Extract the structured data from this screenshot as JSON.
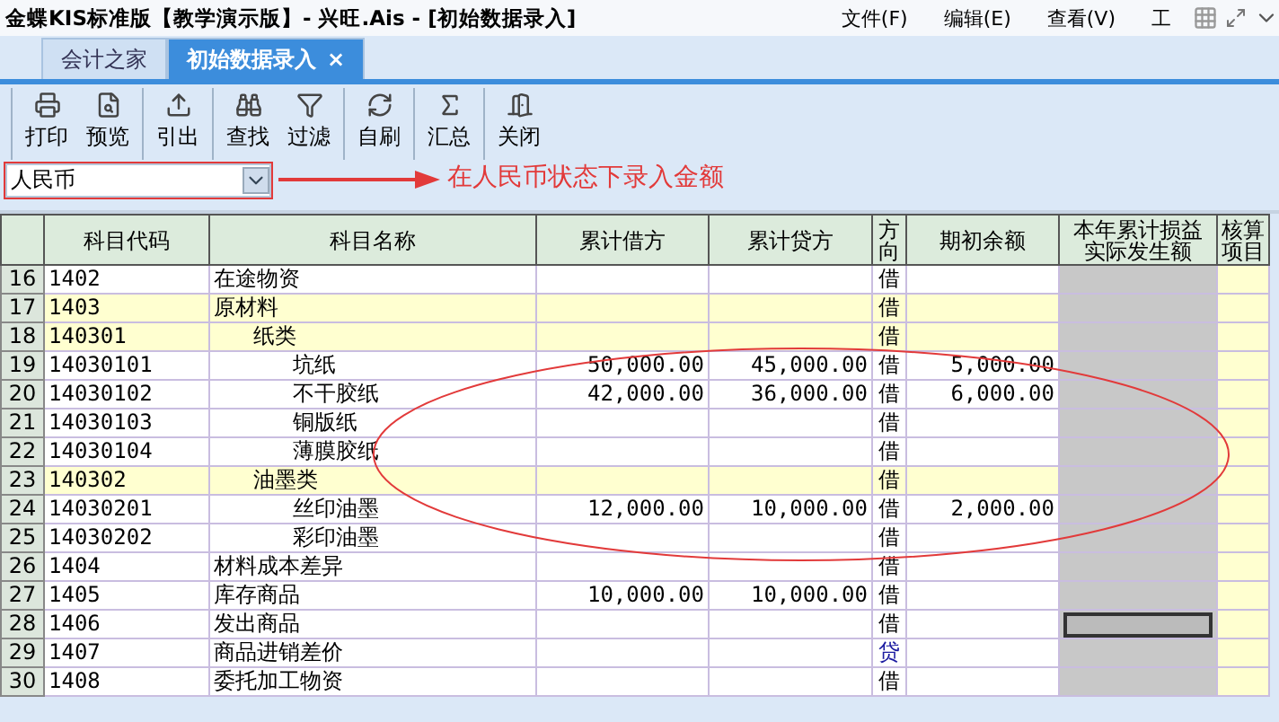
{
  "title_bar": {
    "title": "金蝶KIS标准版【教学演示版】- 兴旺.Ais - [初始数据录入]",
    "menu": [
      "文件(F)",
      "编辑(E)",
      "查看(V)",
      "工"
    ]
  },
  "tabs": [
    {
      "label": "会计之家",
      "selected": false
    },
    {
      "label": "初始数据录入",
      "selected": true,
      "close": "×"
    }
  ],
  "toolbar": [
    [
      {
        "kind": "print",
        "label": "打印"
      },
      {
        "kind": "preview",
        "label": "预览"
      }
    ],
    [
      {
        "kind": "export",
        "label": "引出"
      }
    ],
    [
      {
        "kind": "find",
        "label": "查找"
      },
      {
        "kind": "filter",
        "label": "过滤"
      }
    ],
    [
      {
        "kind": "refresh",
        "label": "自刷"
      }
    ],
    [
      {
        "kind": "sum",
        "label": "汇总"
      }
    ],
    [
      {
        "kind": "close",
        "label": "关闭"
      }
    ]
  ],
  "currency": {
    "value": "人民币"
  },
  "annotation": {
    "text": "在人民币状态下录入金额"
  },
  "table": {
    "columns": [
      {
        "lines": [
          "科目代码"
        ]
      },
      {
        "lines": [
          "科目名称"
        ]
      },
      {
        "lines": [
          "累计借方"
        ]
      },
      {
        "lines": [
          "累计贷方"
        ]
      },
      {
        "lines": [
          "方",
          "向"
        ]
      },
      {
        "lines": [
          "期初余额"
        ]
      },
      {
        "lines": [
          "本年累计损益",
          "实际发生额"
        ]
      },
      {
        "lines": [
          "核算",
          "项目"
        ]
      }
    ],
    "rows": [
      {
        "number": "16",
        "code": "1402",
        "name": "在途物资",
        "direction": "借",
        "selected": false
      },
      {
        "number": "17",
        "code": "1403",
        "name": "原材料",
        "direction": "借",
        "selected": false,
        "children": [
          {
            "number": "18",
            "code": "140301",
            "name": "纸类",
            "direction": "借",
            "selected": false,
            "children": [
              {
                "number": "19",
                "code": "14030101",
                "name": "坑纸",
                "debit": "50,000.00",
                "credit": "45,000.00",
                "direction": "借",
                "opening": "5,000.00",
                "selected": false
              },
              {
                "number": "20",
                "code": "14030102",
                "name": "不干胶纸",
                "debit": "42,000.00",
                "credit": "36,000.00",
                "direction": "借",
                "opening": "6,000.00",
                "selected": false
              },
              {
                "number": "21",
                "code": "14030103",
                "name": "铜版纸",
                "direction": "借",
                "selected": false
              },
              {
                "number": "22",
                "code": "14030104",
                "name": "薄膜胶纸",
                "direction": "借",
                "selected": false
              }
            ]
          },
          {
            "number": "23",
            "code": "140302",
            "name": "油墨类",
            "direction": "借",
            "selected": false,
            "children": [
              {
                "number": "24",
                "code": "14030201",
                "name": "丝印油墨",
                "debit": "12,000.00",
                "credit": "10,000.00",
                "direction": "借",
                "opening": "2,000.00",
                "selected": false
              },
              {
                "number": "25",
                "code": "14030202",
                "name": "彩印油墨",
                "direction": "借",
                "selected": false
              }
            ]
          }
        ]
      },
      {
        "number": "26",
        "code": "1404",
        "name": "材料成本差异",
        "direction": "借",
        "selected": false
      },
      {
        "number": "27",
        "code": "1405",
        "name": "库存商品",
        "debit": "10,000.00",
        "credit": "10,000.00",
        "direction": "借",
        "selected": false
      },
      {
        "number": "28",
        "code": "1406",
        "name": "发出商品",
        "direction": "借",
        "selected": true
      },
      {
        "number": "29",
        "code": "1407",
        "name": "商品进销差价",
        "direction": "贷",
        "color": "#1a1aa0",
        "selected": false
      },
      {
        "number": "30",
        "code": "1408",
        "name": "委托加工物资",
        "direction": "借",
        "selected": false
      }
    ]
  }
}
